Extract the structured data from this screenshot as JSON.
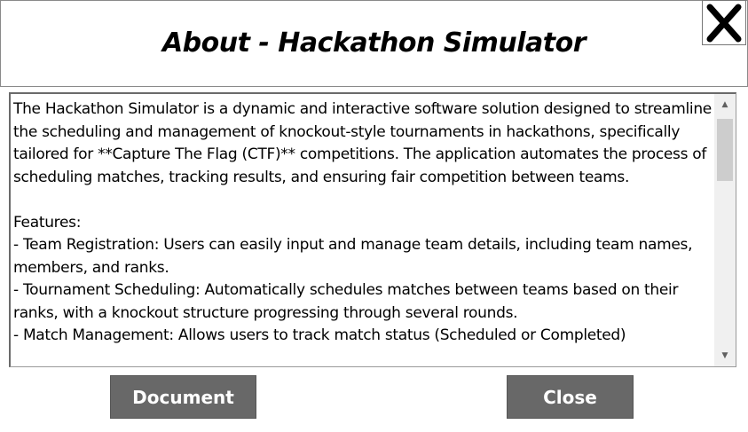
{
  "header": {
    "title": "About - Hackathon Simulator",
    "close_icon": "x-icon"
  },
  "about_text": "The Hackathon Simulator is a dynamic and interactive software solution designed to streamline the scheduling and management of knockout-style tournaments in hackathons, specifically tailored for **Capture The Flag (CTF)** competitions. The application automates the process of scheduling matches, tracking results, and ensuring fair competition between teams.\n\nFeatures:\n- Team Registration: Users can easily input and manage team details, including team names, members, and ranks.\n- Tournament Scheduling: Automatically schedules matches between teams based on their ranks, with a knockout structure progressing through several rounds.\n- Match Management: Allows users to track match status (Scheduled or Completed)",
  "buttons": {
    "document": "Document",
    "close": "Close"
  }
}
